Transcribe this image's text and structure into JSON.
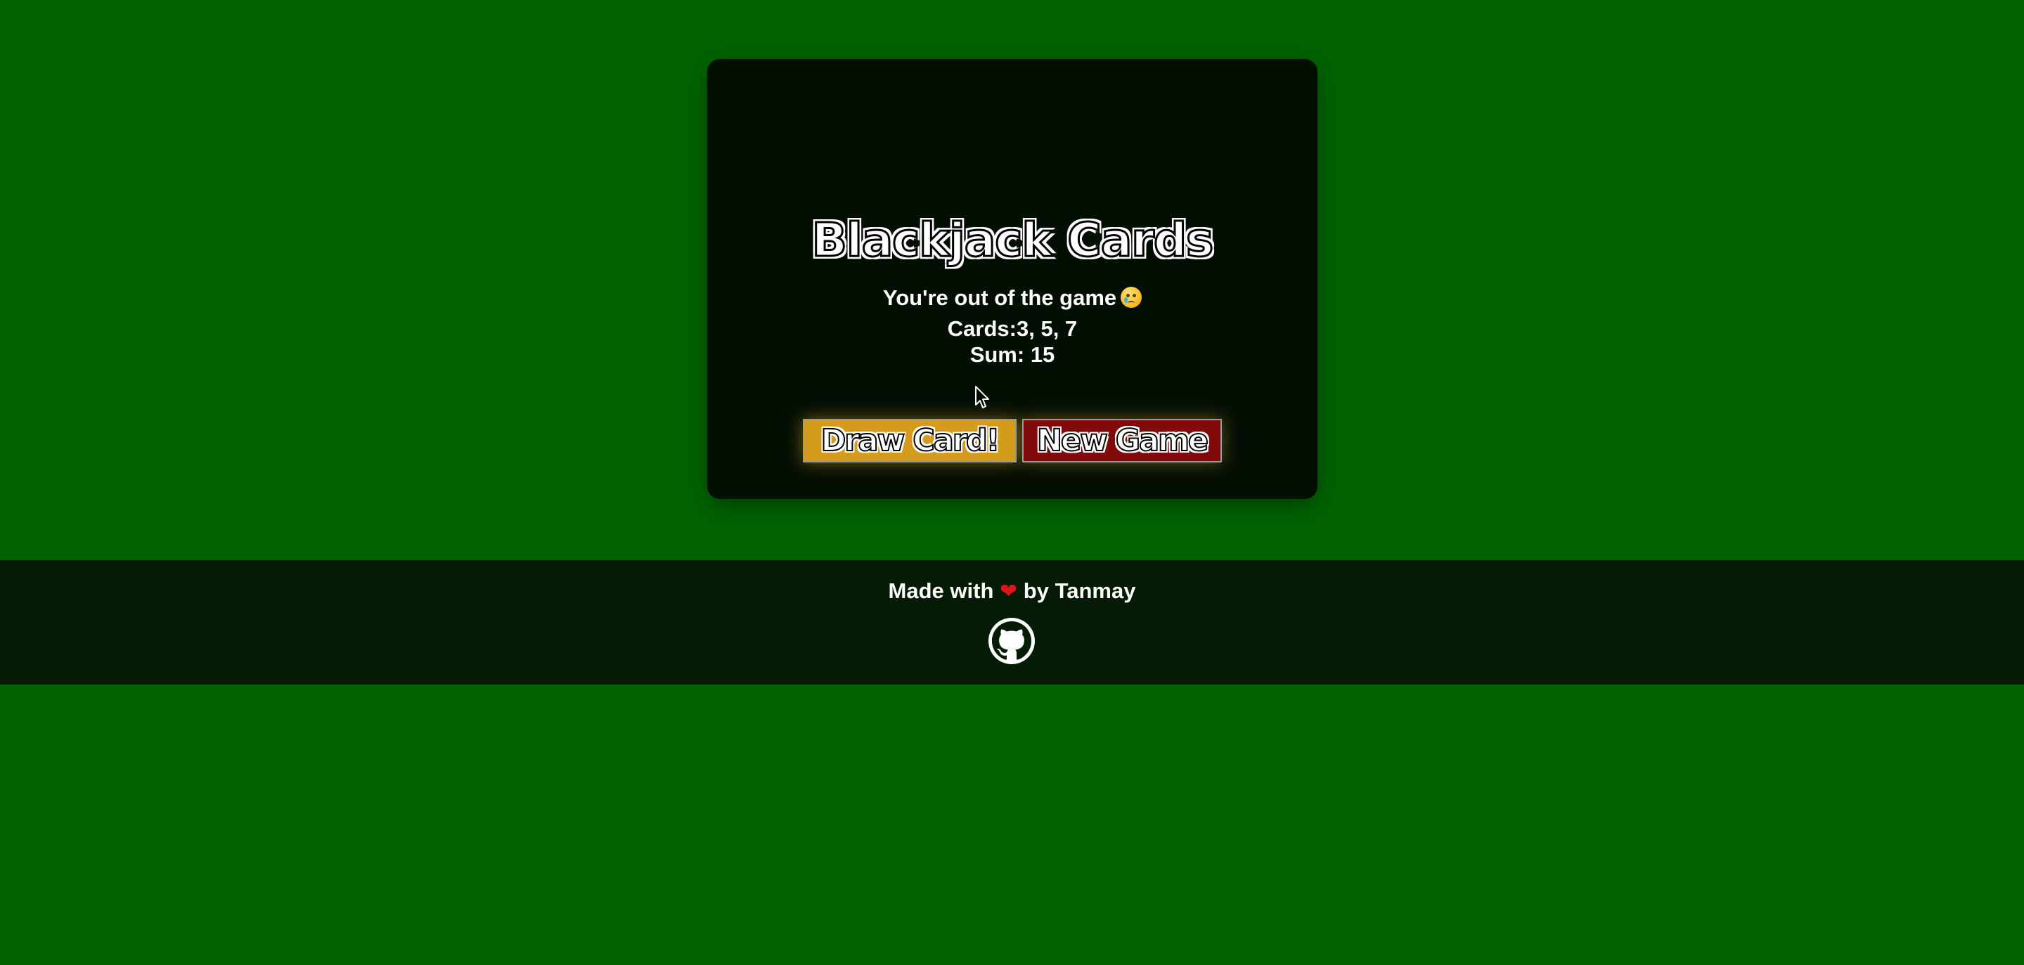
{
  "game": {
    "title": "Blackjack Cards",
    "message": "You're out of the game",
    "message_emoji": "crying-face-icon",
    "cards_label": "Cards:",
    "cards_values": "3, 5, 7",
    "sum_label": "Sum: ",
    "sum_value": "15",
    "draw_button_label": "Draw Card!",
    "new_game_button_label": "New Game"
  },
  "footer": {
    "made_with": "Made with",
    "by_text": "by Tanmay",
    "heart_icon": "heart-icon",
    "github_icon": "github-icon"
  },
  "colors": {
    "background": "#016300",
    "panel": "#040f04",
    "draw_button": "#d49b1d",
    "new_game_button": "#820a0a",
    "footer": "#051b05",
    "heart": "#e0141b"
  }
}
